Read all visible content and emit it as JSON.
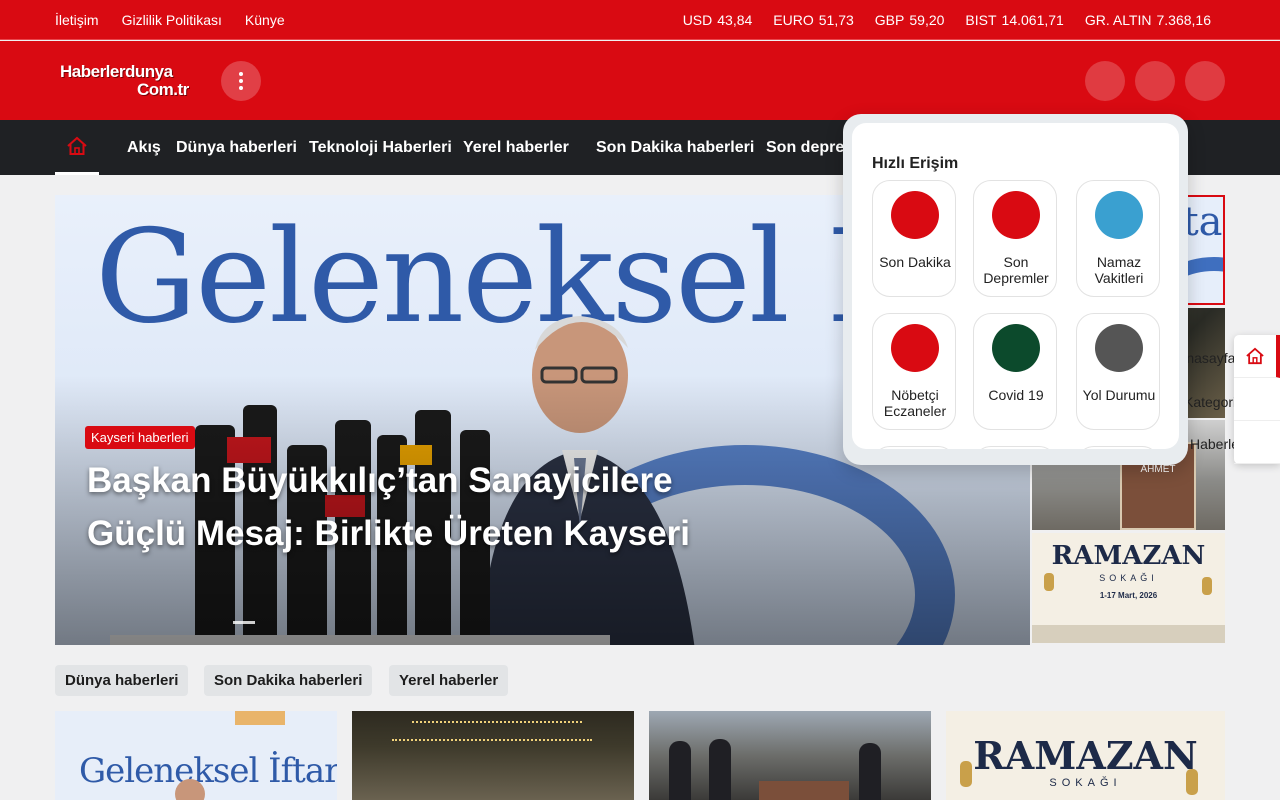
{
  "topbar": {
    "links": [
      "İletişim",
      "Gizlilik Politikası",
      "Künye"
    ],
    "rates": [
      {
        "label": "USD",
        "value": "43,84"
      },
      {
        "label": "EURO",
        "value": "51,73"
      },
      {
        "label": "GBP",
        "value": "59,20"
      },
      {
        "label": "BIST",
        "value": "14.061,71"
      },
      {
        "label": "GR. ALTIN",
        "value": "7.368,16"
      }
    ]
  },
  "header": {
    "logo_line1": "Haberlerdunya",
    "logo_line2": "Com.tr"
  },
  "nav": {
    "items": [
      "Akış",
      "Dünya haberleri",
      "Teknoloji Haberleri",
      "Yerel haberler",
      "Son Dakika haberleri",
      "Son depremler"
    ]
  },
  "hero": {
    "tag": "Kayseri haberleri",
    "title": "Başkan Büyükkılıç’tan Sanayicilere Güçlü Mesaj: Birlikte Üreten Kayseri",
    "bg_text": "Geleneksel İftar"
  },
  "thumbs": {
    "t1_text": "İfta",
    "t3_text": "Dr. SADIK AHMET",
    "t4_title": "RAMAZAN",
    "t4_sub": "SOKAĞI",
    "t4_date": "1-17 Mart, 2026"
  },
  "side": {
    "labels": [
      "Anasayfa",
      "Kategorim",
      "Haberler"
    ]
  },
  "quick_access": {
    "title": "Hızlı Erişim",
    "items": [
      {
        "label": "Son Dakika",
        "color": "#d90a12"
      },
      {
        "label": "Son Depremler",
        "color": "#d90a12"
      },
      {
        "label": "Namaz Vakitleri",
        "color": "#3aa0d0"
      },
      {
        "label": "Nöbetçi Eczaneler",
        "color": "#d90a12"
      },
      {
        "label": "Covid 19",
        "color": "#0c4a2c"
      },
      {
        "label": "Yol Durumu",
        "color": "#555555"
      }
    ]
  },
  "chips": [
    "Dünya haberleri",
    "Son Dakika haberleri",
    "Yerel haberler"
  ],
  "cards": {
    "c1_text": "Geleneksel İftar",
    "c4_title": "RAMAZAN",
    "c4_sub": "SOKAĞI"
  },
  "colors": {
    "brand_red": "#d90a12",
    "nav_dark": "#1f2124"
  }
}
